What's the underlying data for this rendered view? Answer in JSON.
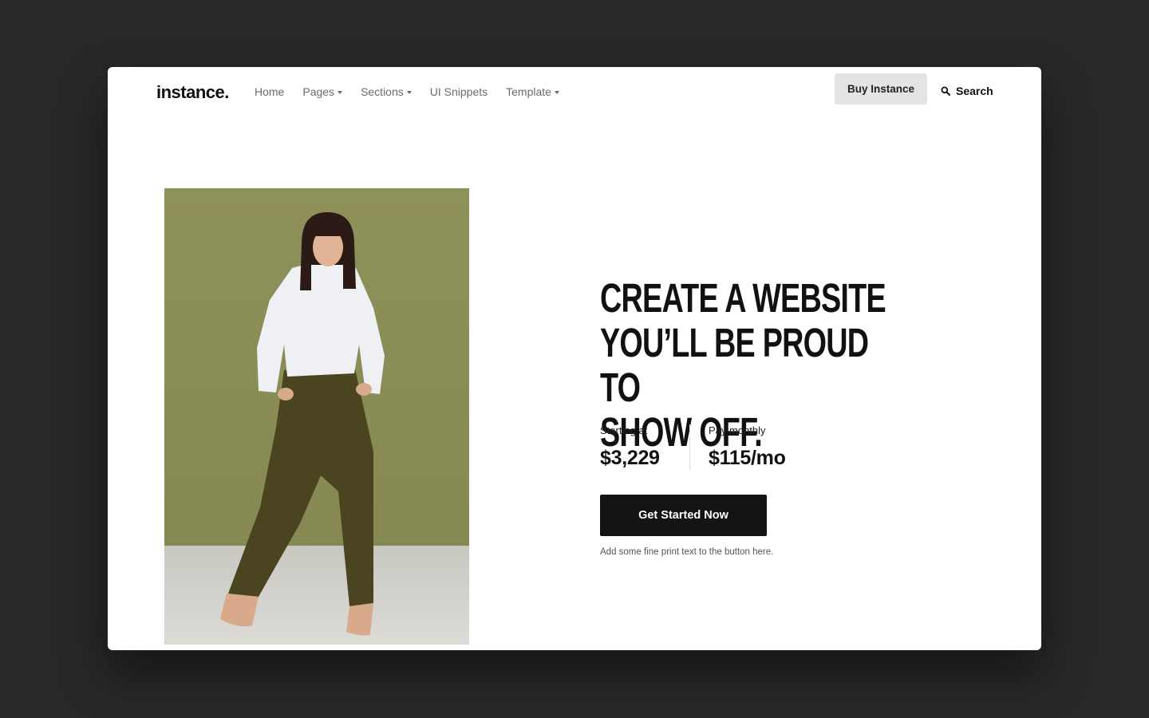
{
  "brand": {
    "logo": "instance."
  },
  "nav": {
    "items": [
      {
        "label": "Home",
        "dropdown": false
      },
      {
        "label": "Pages",
        "dropdown": true
      },
      {
        "label": "Sections",
        "dropdown": true
      },
      {
        "label": "UI Snippets",
        "dropdown": false
      },
      {
        "label": "Template",
        "dropdown": true
      }
    ],
    "buy_button": "Buy Instance",
    "search_label": "Search",
    "search_icon": "search-icon"
  },
  "hero": {
    "headline_lines": [
      "CREATE A WEBSITE",
      "YOU’LL BE PROUD TO",
      "SHOW OFF."
    ],
    "prices": [
      {
        "label": "Starting at",
        "value": "$3,229"
      },
      {
        "label": "Pay monthly",
        "value": "$115/mo"
      }
    ],
    "cta_label": "Get Started Now",
    "fine_print": "Add some fine print text to the button here."
  },
  "colors": {
    "page_background": "#282828",
    "card_background": "#ffffff",
    "cta_background": "#141414",
    "buy_button_background": "#e4e4e4",
    "photo_backdrop": "#8f915c"
  }
}
